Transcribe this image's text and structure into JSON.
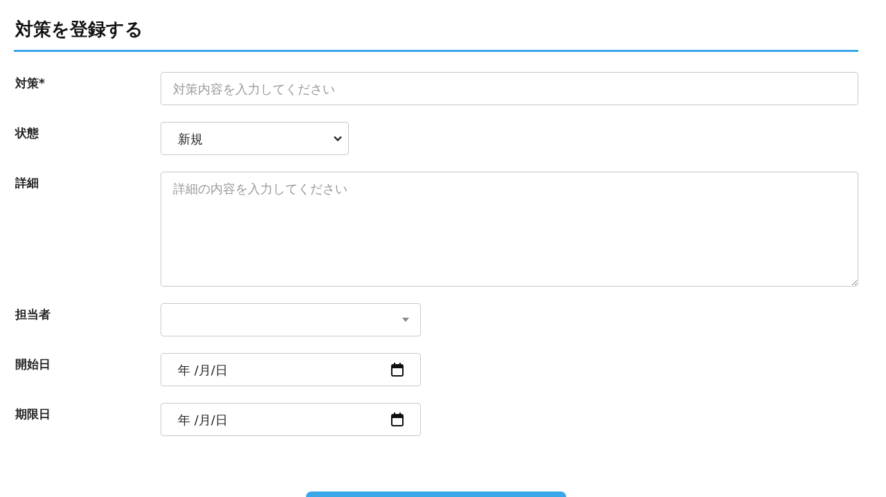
{
  "title": "対策を登録する",
  "fields": [
    {
      "label": "対策*",
      "kind": "text",
      "placeholder": "対策内容を入力してください"
    },
    {
      "label": "状態",
      "kind": "select",
      "value": "新規"
    },
    {
      "label": "詳細",
      "kind": "textarea",
      "placeholder": "詳細の内容を入力してください"
    },
    {
      "label": "担当者",
      "kind": "combobox"
    },
    {
      "label": "開始日",
      "kind": "date",
      "value": "年 /月/日"
    },
    {
      "label": "期限日",
      "kind": "date",
      "value": "年 /月/日"
    }
  ]
}
